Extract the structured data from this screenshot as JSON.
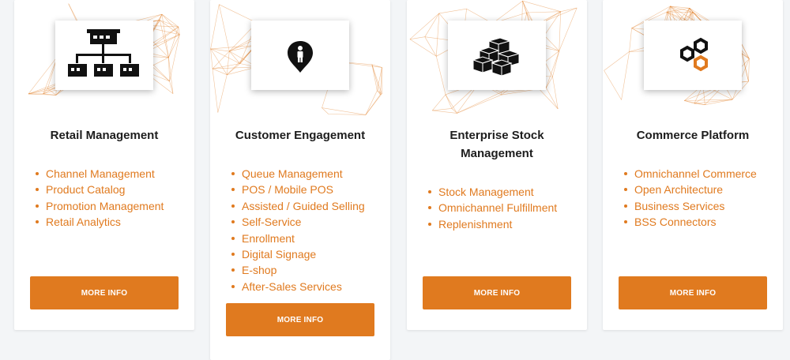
{
  "colors": {
    "accent": "#e07a1f",
    "title": "#1d1d1d",
    "card_background": "#ffffff",
    "page_background": "#f3f5f7"
  },
  "cards": [
    {
      "icon": "retail-stores-hierarchy-icon",
      "title": "Retail Management",
      "features": [
        "Channel Management",
        "Product Catalog",
        "Promotion Management",
        "Retail Analytics"
      ],
      "button_label": "MORE INFO"
    },
    {
      "icon": "customer-location-pin-icon",
      "title": "Customer Engagement",
      "features": [
        "Queue Management",
        "POS / Mobile POS",
        "Assisted / Guided Selling",
        "Self-Service",
        "Enrollment",
        "Digital Signage",
        "E-shop",
        "After-Sales Services"
      ],
      "button_label": "MORE INFO"
    },
    {
      "icon": "stacked-boxes-icon",
      "title": "Enterprise Stock Management",
      "features": [
        "Stock Management",
        "Omnichannel Fulfillment",
        "Replenishment"
      ],
      "button_label": "MORE INFO"
    },
    {
      "icon": "hexagons-icon",
      "title": "Commerce Platform",
      "features": [
        "Omnichannel Commerce",
        "Open Architecture",
        "Business Services",
        "BSS Connectors"
      ],
      "button_label": "MORE INFO"
    }
  ]
}
